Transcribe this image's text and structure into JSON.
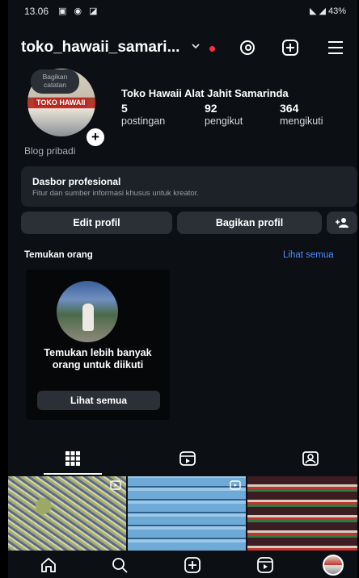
{
  "status_bar": {
    "time": "13.06",
    "battery": "43%"
  },
  "header": {
    "username": "toko_hawaii_samari...",
    "icons": [
      "chevron-down-icon",
      "threads-icon",
      "plus-square-icon",
      "menu-icon"
    ]
  },
  "profile": {
    "note_bubble": "Bagikan catatan",
    "avatar_text": "TOKO HAWAII",
    "display_name": "Toko Hawaii Alat Jahit Samarinda",
    "stats": [
      {
        "value": "5",
        "label": "postingan"
      },
      {
        "value": "92",
        "label": "pengikut"
      },
      {
        "value": "364",
        "label": "mengikuti"
      }
    ],
    "category": "Blog pribadi"
  },
  "dashboard": {
    "title": "Dasbor profesional",
    "subtitle": "Fitur dan sumber informasi khusus untuk kreator."
  },
  "buttons": {
    "edit": "Edit profil",
    "share": "Bagikan profil"
  },
  "discover": {
    "title": "Temukan orang",
    "see_all": "Lihat semua",
    "card_text": "Temukan lebih banyak orang untuk diikuti",
    "card_button": "Lihat semua"
  },
  "tabs": [
    "grid-icon",
    "reels-icon",
    "tagged-icon"
  ],
  "bottom_nav": [
    "home-icon",
    "search-icon",
    "create-icon",
    "reels-icon",
    "profile-avatar"
  ],
  "colors": {
    "background": "#0c0f14",
    "surface": "#2b3036",
    "link": "#4a8cff",
    "notification": "#ff2d4a"
  }
}
